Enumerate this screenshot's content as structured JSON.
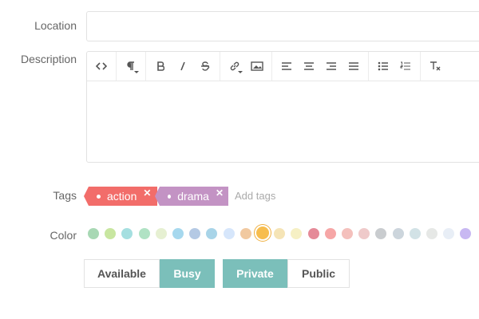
{
  "form": {
    "location_label": "Location",
    "description_label": "Description",
    "tags_label": "Tags",
    "color_label": "Color"
  },
  "location": {
    "value": ""
  },
  "editor": {
    "toolbar": [
      "code-view-icon",
      "paragraph-format-icon",
      "bold-icon",
      "italic-icon",
      "strikethrough-icon",
      "link-icon",
      "image-icon",
      "align-left-icon",
      "align-center-icon",
      "align-right-icon",
      "align-justify-icon",
      "bulleted-list-icon",
      "numbered-list-icon",
      "clear-formatting-icon"
    ],
    "content": ""
  },
  "tags": {
    "items": [
      {
        "label": "action",
        "color": "#f26d6a"
      },
      {
        "label": "drama",
        "color": "#c393c4"
      }
    ],
    "placeholder": "Add tags"
  },
  "colors": {
    "swatches": [
      "#a8d8b4",
      "#c8e6a0",
      "#a5dfe0",
      "#b0e2c4",
      "#e6f0d2",
      "#a6d8ee",
      "#b4c9e4",
      "#a8d4e8",
      "#d6e6fb",
      "#f1c9a0",
      "#f7bd4e",
      "#f5e4b6",
      "#f6f0c4",
      "#e58a98",
      "#f6a6a6",
      "#f4c0bc",
      "#efcaca",
      "#c9cccf",
      "#ccd5dc",
      "#d2e2e6",
      "#e6e8e6",
      "#e8eef6",
      "#c8b8f2",
      "#d9c9f0"
    ],
    "selected_index": 10
  },
  "availability": {
    "options": [
      "Available",
      "Busy"
    ],
    "selected": "Busy"
  },
  "visibility": {
    "options": [
      "Private",
      "Public"
    ],
    "selected": "Private"
  }
}
